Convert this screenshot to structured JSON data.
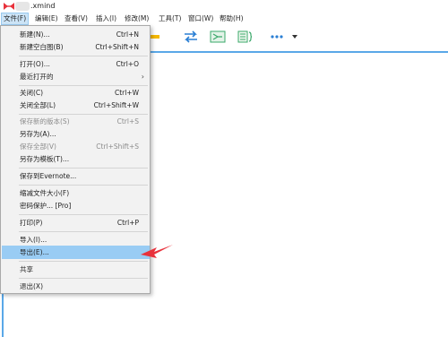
{
  "window": {
    "title": ".xmind"
  },
  "menubar": [
    {
      "label": "文件(F)"
    },
    {
      "label": "编辑(E)"
    },
    {
      "label": "查看(V)"
    },
    {
      "label": "插入(I)"
    },
    {
      "label": "修改(M)"
    },
    {
      "label": "工具(T)"
    },
    {
      "label": "窗口(W)"
    },
    {
      "label": "帮助(H)"
    }
  ],
  "toolbar": {
    "icons": [
      "boundary-icon",
      "relationship-icon",
      "summary-icon",
      "notes-icon",
      "bracket-icon",
      "more-icon",
      "dropdown-arrow-icon"
    ]
  },
  "file_menu": {
    "items": [
      {
        "label": "新建(N)...",
        "shortcut": "Ctrl+N"
      },
      {
        "label": "新建空白图(B)",
        "shortcut": "Ctrl+Shift+N"
      },
      {
        "label": "打开(O)...",
        "shortcut": "Ctrl+O"
      },
      {
        "label": "最近打开的",
        "shortcut": ""
      },
      {
        "label": "关闭(C)",
        "shortcut": "Ctrl+W"
      },
      {
        "label": "关闭全部(L)",
        "shortcut": "Ctrl+Shift+W"
      },
      {
        "label": "保存新的版本(S)",
        "shortcut": "Ctrl+S",
        "disabled": true
      },
      {
        "label": "另存为(A)...",
        "shortcut": ""
      },
      {
        "label": "保存全部(V)",
        "shortcut": "Ctrl+Shift+S",
        "disabled": true
      },
      {
        "label": "另存为模板(T)...",
        "shortcut": ""
      },
      {
        "label": "保存到Evernote...",
        "shortcut": ""
      },
      {
        "label": "缩减文件大小(F)",
        "shortcut": ""
      },
      {
        "label": "密码保护... [Pro]",
        "shortcut": ""
      },
      {
        "label": "打印(P)",
        "shortcut": "Ctrl+P"
      },
      {
        "label": "导入(I)...",
        "shortcut": ""
      },
      {
        "label": "导出(E)...",
        "shortcut": "",
        "highlighted": true
      },
      {
        "label": "共享",
        "shortcut": ""
      },
      {
        "label": "退出(X)",
        "shortcut": ""
      }
    ],
    "submenu_arrow": "›"
  },
  "colors": {
    "highlight": "#99ccf4",
    "accent": "#5aa8e8",
    "pointer": "#e8323c"
  }
}
